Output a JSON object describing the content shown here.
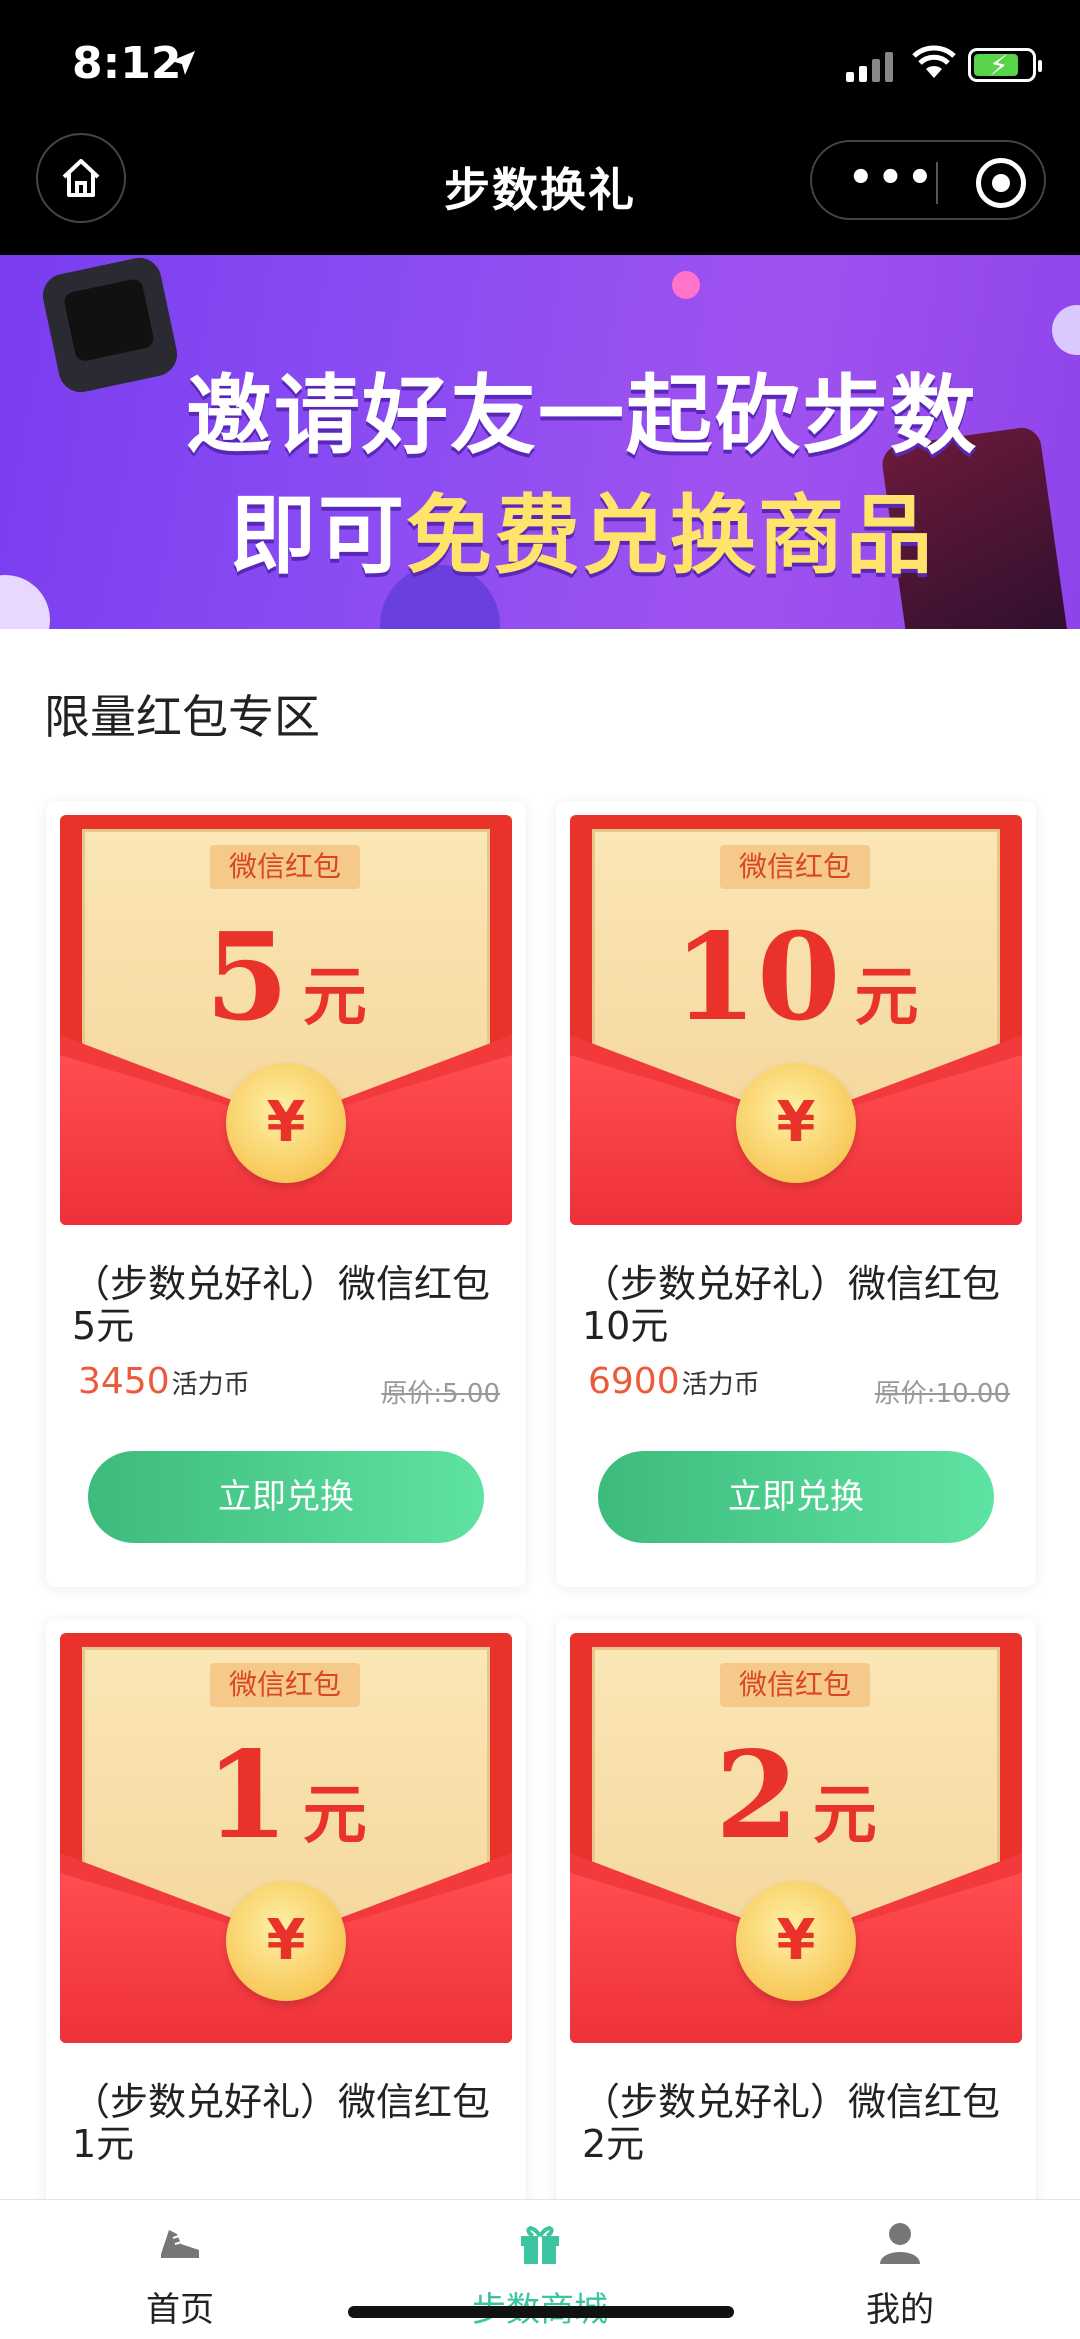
{
  "status_bar": {
    "time": "8:12"
  },
  "navbar": {
    "title": "步数换礼"
  },
  "banner": {
    "line1": "邀请好友一起砍步数",
    "line2_prefix": "即可",
    "line2_highlight": "免费兑换商品"
  },
  "section": {
    "title": "限量红包专区"
  },
  "products": [
    {
      "tag": "微信红包",
      "amount": "5",
      "unit": "元",
      "name": "（步数兑好礼）微信红包5元",
      "price": "3450",
      "price_unit": "活力币",
      "original": "原价:5.00",
      "button": "立即兑换"
    },
    {
      "tag": "微信红包",
      "amount": "10",
      "unit": "元",
      "name": "（步数兑好礼）微信红包10元",
      "price": "6900",
      "price_unit": "活力币",
      "original": "原价:10.00",
      "button": "立即兑换"
    },
    {
      "tag": "微信红包",
      "amount": "1",
      "unit": "元",
      "name": "（步数兑好礼）微信红包1元"
    },
    {
      "tag": "微信红包",
      "amount": "2",
      "unit": "元",
      "name": "（步数兑好礼）微信红包2元"
    }
  ],
  "coin_symbol": "¥",
  "tabbar": {
    "items": [
      {
        "label": "首页",
        "icon": "shoe-icon"
      },
      {
        "label": "步数商城",
        "icon": "gift-icon",
        "active": true
      },
      {
        "label": "我的",
        "icon": "user-icon"
      }
    ]
  },
  "colors": {
    "active_tab": "#3cc4a0",
    "accent_green": "#4ecf8e",
    "red_packet": "#e8322a",
    "price_orange": "#ec5a3a"
  }
}
